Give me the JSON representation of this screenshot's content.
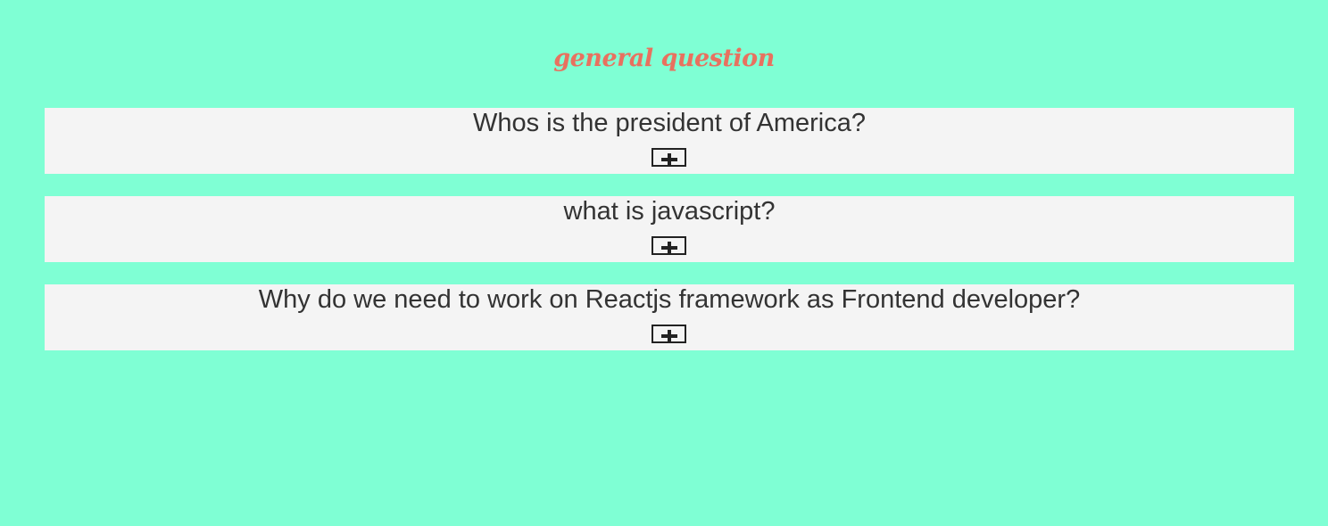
{
  "page": {
    "title": "general question"
  },
  "faq": {
    "items": [
      {
        "question": "Whos is the president of America?",
        "toggle_icon": "plus-icon"
      },
      {
        "question": "what is javascript?",
        "toggle_icon": "plus-icon"
      },
      {
        "question": "Why do we need to work on Reactjs framework as Frontend developer?",
        "toggle_icon": "plus-icon"
      }
    ]
  },
  "colors": {
    "background": "#7fffd4",
    "title": "#e8715f",
    "card": "#f4f4f4",
    "text": "#333333"
  }
}
